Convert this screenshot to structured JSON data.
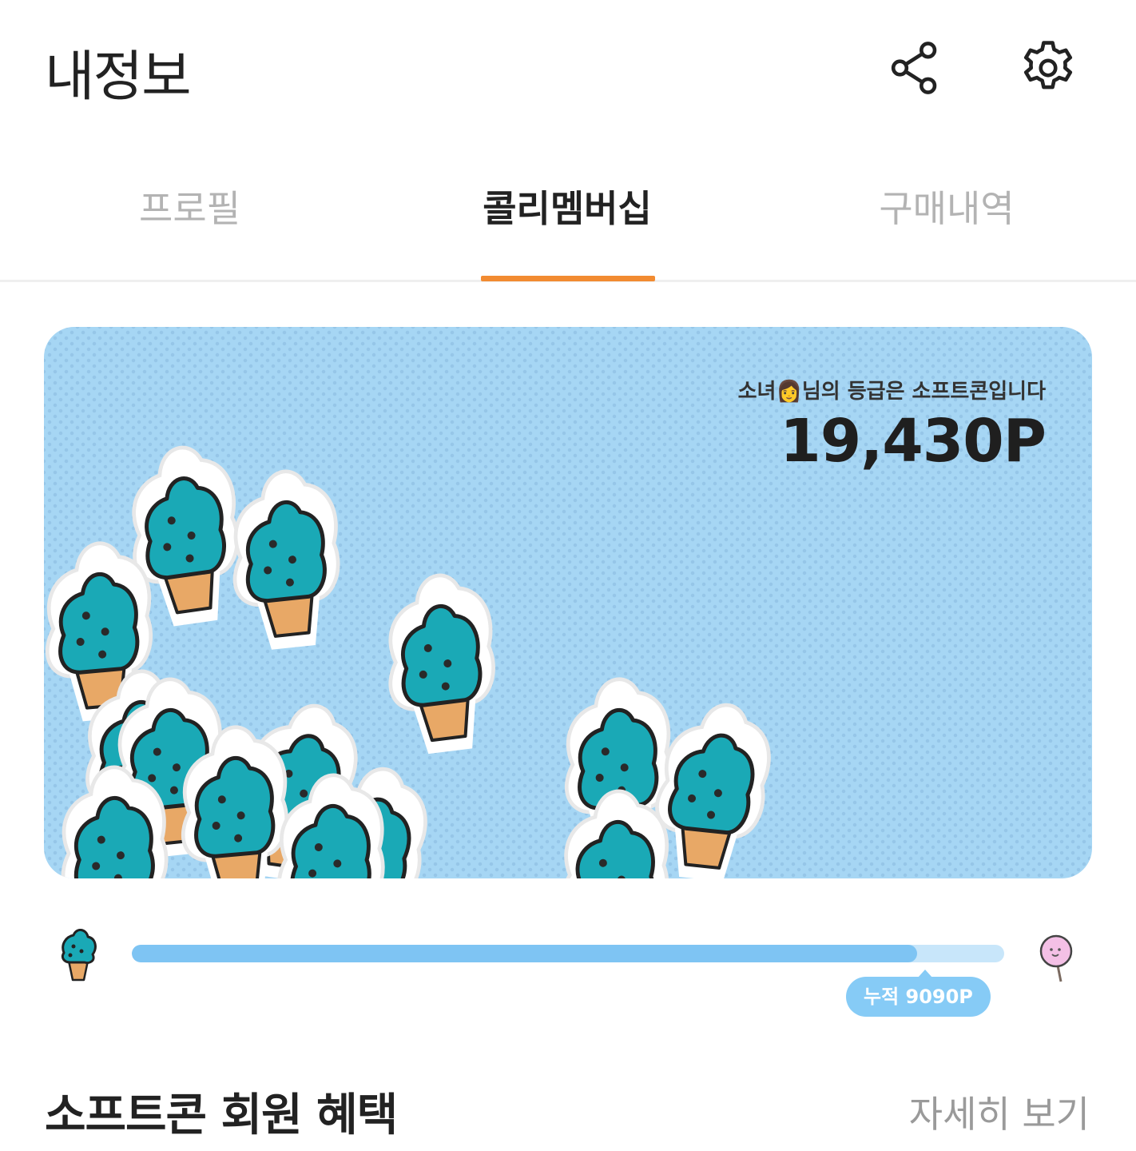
{
  "header": {
    "title": "내정보",
    "share_icon": "share-icon",
    "settings_icon": "gear-icon"
  },
  "tabs": [
    {
      "label": "프로필",
      "active": false
    },
    {
      "label": "콜리멤버십",
      "active": true
    },
    {
      "label": "구매내역",
      "active": false
    }
  ],
  "colors": {
    "accent": "#f28b31",
    "card_background": "#a6d6f4",
    "progress_fill": "#7ec4f3",
    "progress_track": "#c8e6fa",
    "progress_label_bg": "#86cbf6",
    "cone_teal": "#1aa9b6",
    "cone_waffle": "#e8a866"
  },
  "grade_card": {
    "message": "소녀👩님의 등급은 소프트콘입니다",
    "points": "19,430P",
    "decoration": "soft-serve-cone stickers"
  },
  "progress": {
    "current_grade_icon": "soft-serve-cone-icon",
    "next_grade_icon": "cotton-candy-icon",
    "fill_fraction": 0.9,
    "label": "누적 9090P"
  },
  "benefits": {
    "title": "소프트콘 회원 혜택",
    "more_label": "자세히 보기"
  }
}
